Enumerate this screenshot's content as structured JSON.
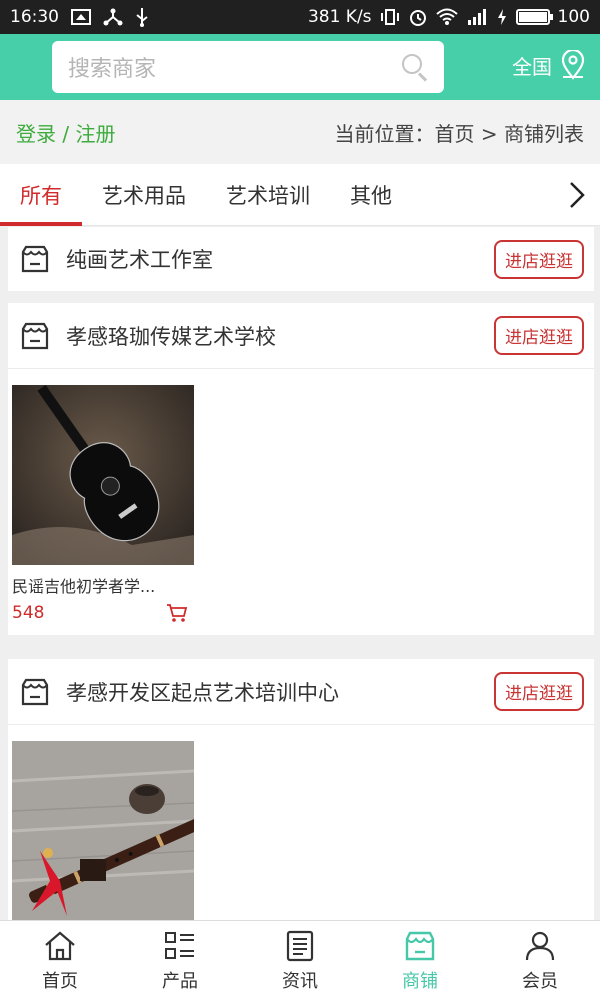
{
  "status_bar": {
    "time": "16:30",
    "speed": "381 K/s",
    "battery": "100",
    "battery_level": 1.0
  },
  "header": {
    "search_placeholder": "搜索商家",
    "region": "全国"
  },
  "crumb_bar": {
    "login": "登录 / 注册",
    "location": "当前位置：首页 > 商铺列表"
  },
  "tabs": [
    {
      "label": "所有",
      "active": true
    },
    {
      "label": "艺术用品",
      "active": false
    },
    {
      "label": "艺术培训",
      "active": false
    },
    {
      "label": "其他",
      "active": false
    }
  ],
  "shops": [
    {
      "name": "纯画艺术工作室",
      "button": "进店逛逛",
      "products": []
    },
    {
      "name": "孝感珞珈传媒艺术学校",
      "button": "进店逛逛",
      "products": [
        {
          "title": "民谣吉他初学者学...",
          "price": "548"
        }
      ]
    },
    {
      "name": "孝感开发区起点艺术培训中心",
      "button": "进店逛逛",
      "products": [
        {
          "title": "",
          "price": ""
        }
      ]
    }
  ],
  "bottom_nav": [
    {
      "label": "首页",
      "icon": "home-icon",
      "active": false
    },
    {
      "label": "产品",
      "icon": "grid-list-icon",
      "active": false
    },
    {
      "label": "资讯",
      "icon": "news-icon",
      "active": false
    },
    {
      "label": "商铺",
      "icon": "store-icon",
      "active": true
    },
    {
      "label": "会员",
      "icon": "user-icon",
      "active": false
    }
  ],
  "colors": {
    "header_bg": "#46cfa8",
    "accent_red": "#d02a2a",
    "login_green": "#3eab3e",
    "nav_active": "#46c7a8"
  }
}
